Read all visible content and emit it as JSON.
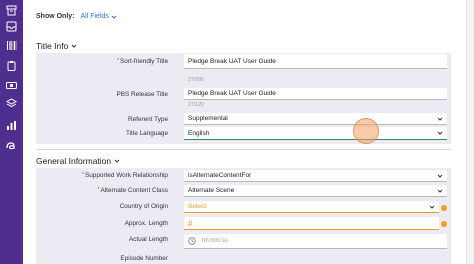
{
  "nav": {
    "icons": [
      "archive-icon",
      "inbox-icon",
      "barcode-icon",
      "clipboard-icon",
      "cash-icon",
      "layers-icon",
      "bar-chart-icon",
      "a-logo-icon"
    ]
  },
  "filter": {
    "label": "Show Only:",
    "value": "All Fields"
  },
  "title_info": {
    "heading": "Title Info",
    "sort_friendly": {
      "label": "Sort-friendly Title",
      "value": "Pledge Break UAT User Guide",
      "counter": "27/500"
    },
    "pbs_release": {
      "label": "PBS Release Title",
      "value": "Pledge Break UAT User Guide",
      "counter": "27/120"
    },
    "referent_type": {
      "label": "Referent Type",
      "value": "Supplemental"
    },
    "title_language": {
      "label": "Title Language",
      "value": "English"
    }
  },
  "general_info": {
    "heading": "General Information",
    "supported_work": {
      "label": "Supported Work Relationship",
      "value": "isAlternateContentFor"
    },
    "alternate_content_class": {
      "label": "Alternate Content Class",
      "value": "Alternate Scene"
    },
    "country_of_origin": {
      "label": "Country of Origin",
      "placeholder": "Select"
    },
    "approx_length": {
      "label": "Approx. Length",
      "placeholder": "#"
    },
    "actual_length": {
      "label": "Actual Length",
      "placeholder": "hh:mm:ss"
    },
    "episode_number": {
      "label": "Episode Number"
    }
  },
  "colors": {
    "rail": "#4e2f8f",
    "accent": "#3b6fd4",
    "warning": "#e9a21f",
    "panel": "#ecebf4"
  }
}
